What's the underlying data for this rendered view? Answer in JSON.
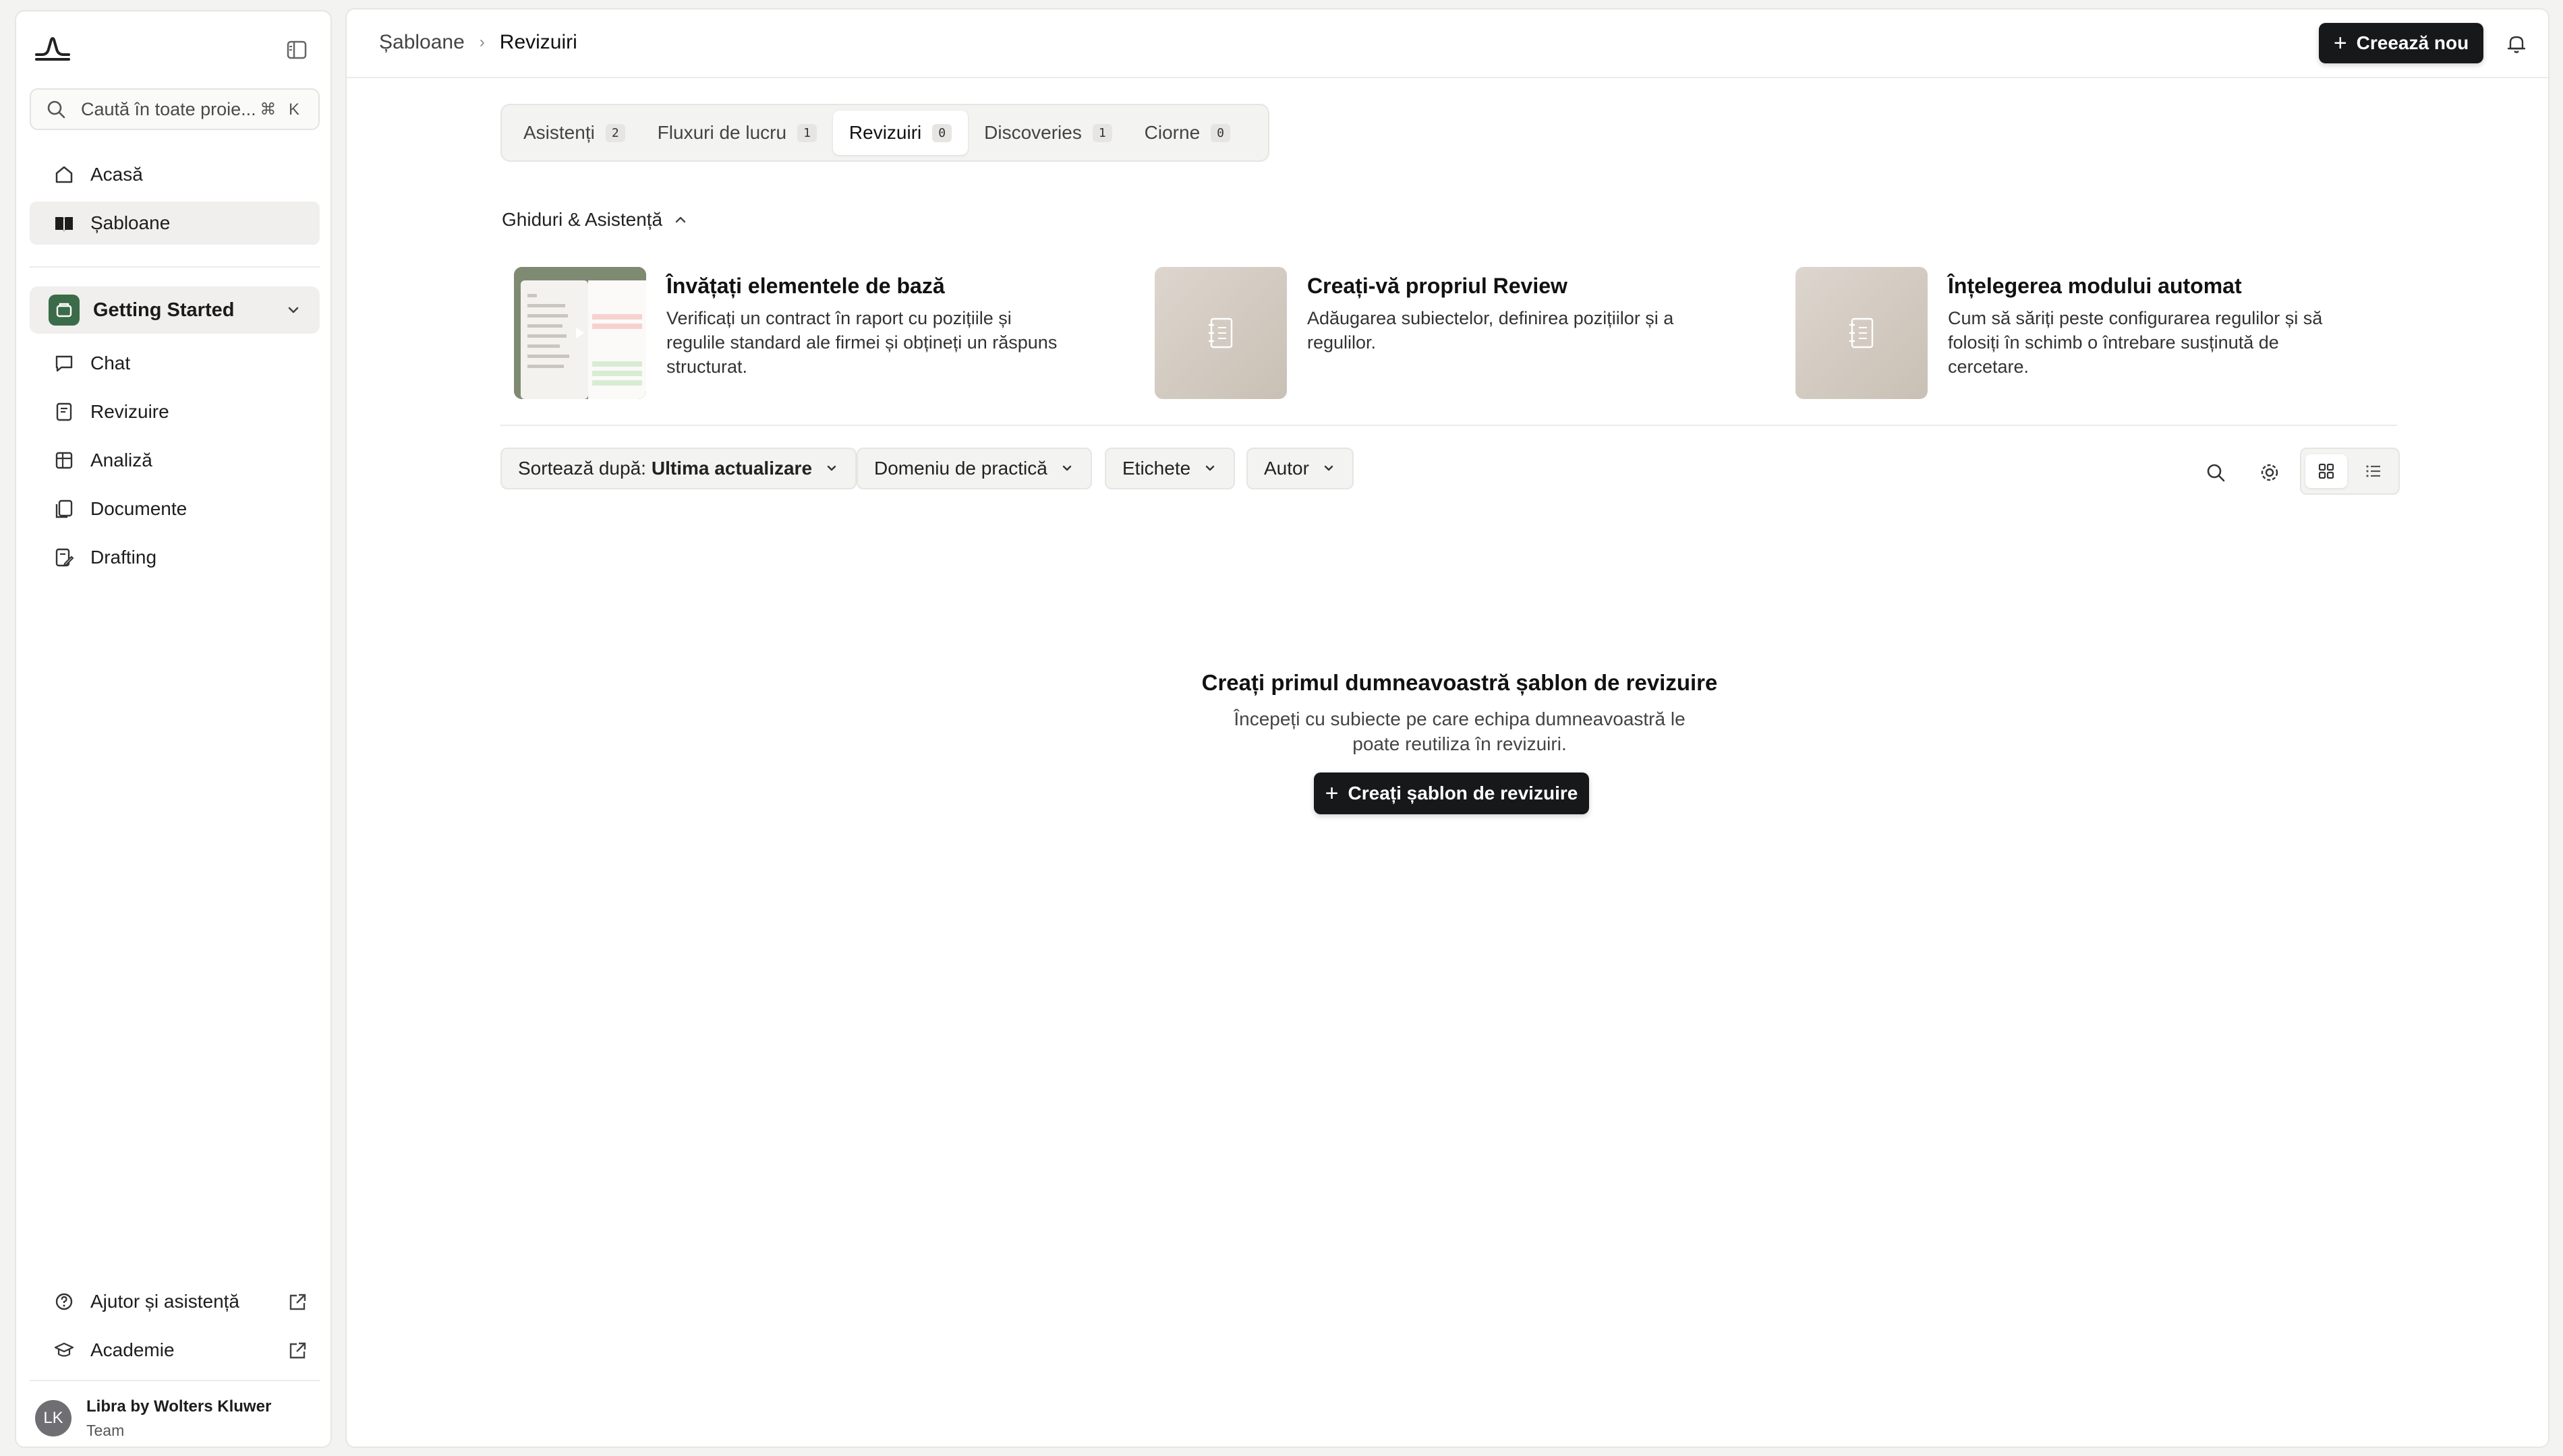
{
  "sidebar": {
    "search_placeholder": "Caută în toate proie...",
    "search_shortcut": "⌘ K",
    "nav_top": [
      {
        "label": "Acasă",
        "icon": "home-icon"
      },
      {
        "label": "Șabloane",
        "icon": "book-icon",
        "active": true
      }
    ],
    "project": {
      "label": "Getting Started"
    },
    "nav_project": [
      {
        "label": "Chat",
        "icon": "chat-icon"
      },
      {
        "label": "Revizuire",
        "icon": "review-icon"
      },
      {
        "label": "Analiză",
        "icon": "table-icon"
      },
      {
        "label": "Documente",
        "icon": "documents-icon"
      },
      {
        "label": "Drafting",
        "icon": "drafting-icon"
      }
    ],
    "nav_bottom": [
      {
        "label": "Ajutor și asistență",
        "icon": "help-icon"
      },
      {
        "label": "Academie",
        "icon": "academy-icon"
      }
    ],
    "user": {
      "initials": "LK",
      "name": "Libra by Wolters Kluwer",
      "role": "Team"
    }
  },
  "header": {
    "breadcrumb": [
      "Șabloane",
      "Revizuiri"
    ],
    "create_label": "Creează nou"
  },
  "tabs": [
    {
      "label": "Asistenți",
      "count": "2"
    },
    {
      "label": "Fluxuri de lucru",
      "count": "1"
    },
    {
      "label": "Revizuiri",
      "count": "0",
      "active": true
    },
    {
      "label": "Discoveries",
      "count": "1"
    },
    {
      "label": "Ciorne",
      "count": "0"
    }
  ],
  "guides": {
    "heading": "Ghiduri & Asistență",
    "items": [
      {
        "title": "Învățați elementele de bază",
        "desc": "Verificați un contract în raport cu pozițiile și regulile standard ale firmei și obțineți un răspuns structurat."
      },
      {
        "title": "Creați-vă propriul Review",
        "desc": "Adăugarea subiectelor, definirea pozițiilor și a regulilor."
      },
      {
        "title": "Înțelegerea modului automat",
        "desc": "Cum să săriți peste configurarea regulilor și să folosiți în schimb o întrebare susținută de cercetare."
      }
    ]
  },
  "filters": {
    "sort_label": "Sortează după:",
    "sort_value": "Ultima actualizare",
    "practice": "Domeniu de practică",
    "tags": "Etichete",
    "author": "Autor"
  },
  "empty_state": {
    "title": "Creați primul dumneavoastră șablon de revizuire",
    "desc": "Începeți cu subiecte pe care echipa dumneavoastră le poate reutiliza în revizuiri.",
    "button": "Creați șablon de revizuire"
  },
  "colors": {
    "primary_button": "#17181a",
    "project_badge": "#3c6b4a",
    "background": "#f3f3f2"
  }
}
